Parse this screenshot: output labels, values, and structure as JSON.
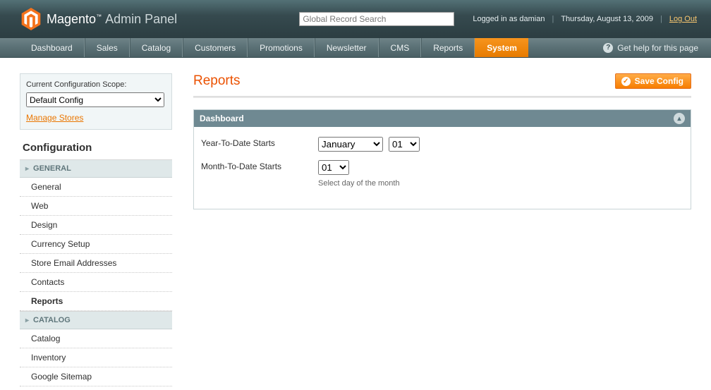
{
  "header": {
    "brand_main": "Magento",
    "brand_sub": "Admin Panel",
    "search_placeholder": "Global Record Search",
    "logged_in": "Logged in as damian",
    "date": "Thursday, August 13, 2009",
    "logout": "Log Out"
  },
  "nav": {
    "items": [
      "Dashboard",
      "Sales",
      "Catalog",
      "Customers",
      "Promotions",
      "Newsletter",
      "CMS",
      "Reports",
      "System"
    ],
    "active_index": 8,
    "help": "Get help for this page"
  },
  "sidebar": {
    "scope_label": "Current Configuration Scope:",
    "scope_value": "Default Config",
    "manage": "Manage Stores",
    "title": "Configuration",
    "groups": [
      {
        "head": "GENERAL",
        "items": [
          "General",
          "Web",
          "Design",
          "Currency Setup",
          "Store Email Addresses",
          "Contacts",
          "Reports"
        ],
        "active_index": 6
      },
      {
        "head": "CATALOG",
        "items": [
          "Catalog",
          "Inventory",
          "Google Sitemap"
        ],
        "active_index": -1
      }
    ]
  },
  "main": {
    "title": "Reports",
    "save_btn": "Save Config",
    "panel_title": "Dashboard",
    "fields": {
      "ytd_label": "Year-To-Date Starts",
      "ytd_month": "January",
      "ytd_day": "01",
      "mtd_label": "Month-To-Date Starts",
      "mtd_day": "01",
      "mtd_hint": "Select day of the month"
    }
  }
}
